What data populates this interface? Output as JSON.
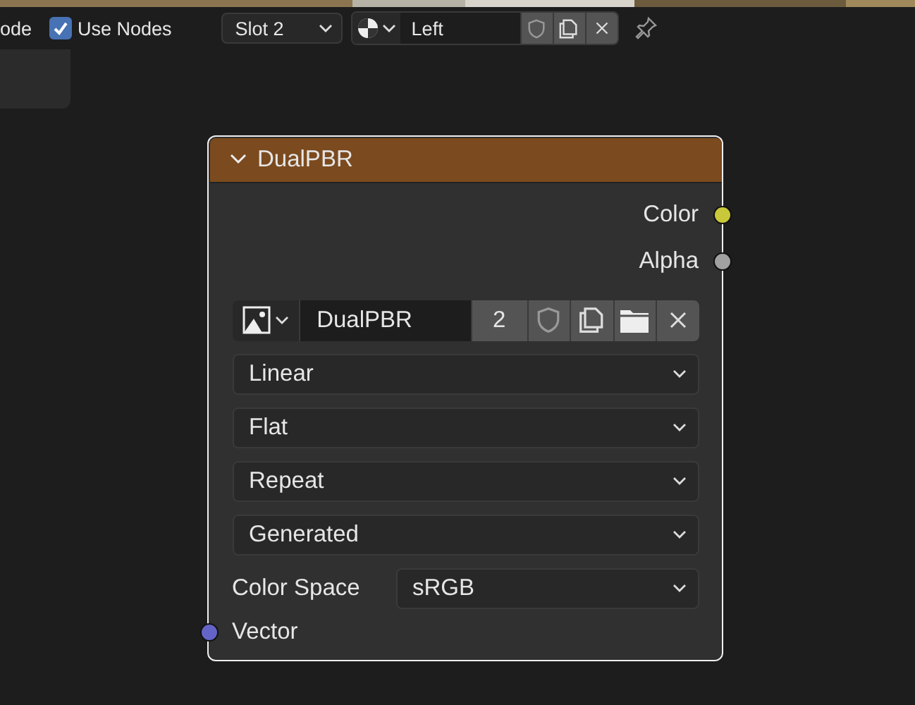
{
  "header": {
    "editor_label": "ode",
    "use_nodes": {
      "label": "Use Nodes",
      "checked": true
    },
    "slot": {
      "value": "Slot 2"
    },
    "material": {
      "name": "Left"
    }
  },
  "node": {
    "title": "DualPBR",
    "expanded": true,
    "selected": true,
    "outputs": [
      {
        "label": "Color",
        "color": "#c8c83a"
      },
      {
        "label": "Alpha",
        "color": "#a1a1a1"
      }
    ],
    "image": {
      "name": "DualPBR",
      "users": "2"
    },
    "dropdowns": [
      {
        "value": "Linear"
      },
      {
        "value": "Flat"
      },
      {
        "value": "Repeat"
      },
      {
        "value": "Generated"
      }
    ],
    "color_space": {
      "label": "Color Space",
      "value": "sRGB"
    },
    "inputs": [
      {
        "label": "Vector",
        "color": "#6464c8"
      }
    ]
  }
}
